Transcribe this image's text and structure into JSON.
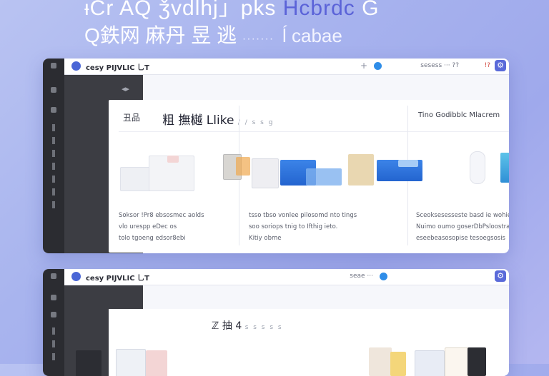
{
  "hero": {
    "line1_a": "ᵻCr AQ ǯvdlhj」pks",
    "line1_b": "Hcbrdc",
    "line1_c": "G",
    "line2_a": "Q鉄网 麻丹 昱 逃",
    "line2_dots": "·······",
    "line2_b": "ĺ cabae"
  },
  "window1": {
    "titlebar": {
      "title": "cesy PIJVLIC 乚T",
      "plus": "+",
      "right_text": "sesess ··· ??",
      "flag": "!?"
    },
    "columns": [
      {
        "heading": "丑品",
        "desc": [
          "Soksor !Pr8 ebsosmec aolds",
          "vlo urespp eDec os",
          "tolo tgoeng edsor8ebi"
        ]
      },
      {
        "heading": "粗 撫樾 Llike",
        "heading_small": "/ / s s g",
        "desc": [
          "tsso tbso vonlee pilosomd nto tings",
          "soo soriops tnig to Ifthig ieto.",
          "Kitiy obme"
        ]
      },
      {
        "heading": "Tino Godibblc Mlacrem",
        "desc": [
          "Sceoksesesseste basd ie wohieakse",
          "Nuimo oumo goserDbPsloostra ueas",
          "eseebeasosopise tesoegsosis"
        ]
      }
    ]
  },
  "window2": {
    "titlebar": {
      "title": "cesy PIJVLIC 乚T",
      "plus": "+",
      "right_text": "seae ···",
      "flag": ""
    },
    "label": "ℤ 抽 4",
    "label_small": "s s s s s"
  },
  "colors": {
    "accent": "#4a66d6",
    "rail": "#2b2c31",
    "blue": "#2f76df"
  }
}
